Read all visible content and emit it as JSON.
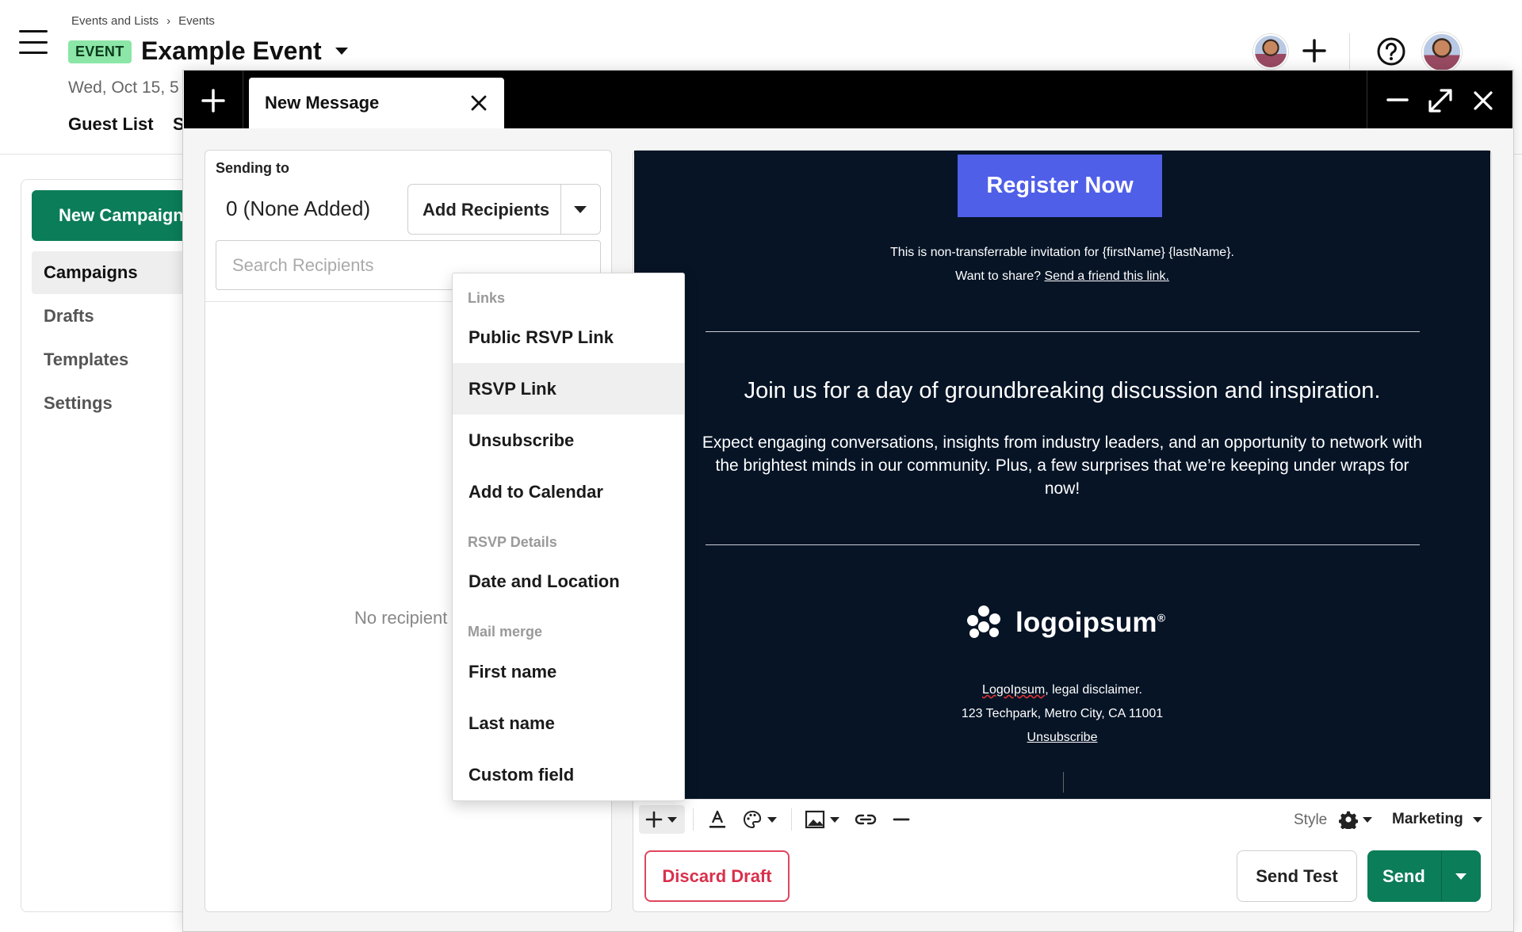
{
  "header": {
    "breadcrumb": [
      "Events and Lists",
      "Events"
    ],
    "breadcrumb_separator": "›",
    "badge": "EVENT",
    "title": "Example Event",
    "date": "Wed, Oct 15, 5",
    "tabs": [
      "Guest List",
      "S"
    ]
  },
  "sidebar": {
    "new_campaign": "New Campaign",
    "items": [
      "Campaigns",
      "Drafts",
      "Templates",
      "Settings"
    ],
    "active": "Campaigns"
  },
  "composer": {
    "tab_title": "New Message",
    "recipients": {
      "sending_to_label": "Sending to",
      "count_text": "0 (None Added)",
      "add_button": "Add Recipients",
      "search_placeholder": "Search Recipients",
      "empty_text": "No recipient"
    },
    "email": {
      "cta": "Register Now",
      "invite_line": "This is non-transferrable invitation for {firstName} {lastName}.",
      "share_prefix": "Want to share?",
      "share_link": "Send a friend this link.",
      "headline": "Join us for a day of groundbreaking discussion and inspiration.",
      "body": "Expect engaging conversations, insights from industry leaders, and an opportunity to network with the brightest minds in our community. Plus, a few surprises that we’re keeping under wraps for now!",
      "logo_text": "logoipsum",
      "logo_mark": "®",
      "disclaimer_brand": "LogoIpsum",
      "disclaimer_rest": ", legal disclaimer.",
      "address": "123 Techpark, Metro City, CA 11001",
      "unsubscribe": "Unsubscribe"
    },
    "toolbar": {
      "style_label": "Style",
      "template_label": "Marketing",
      "icons": [
        "plus-icon",
        "text-color-icon",
        "palette-icon",
        "image-icon",
        "link-icon",
        "divider-icon",
        "gear-icon"
      ]
    },
    "footer": {
      "discard": "Discard Draft",
      "send_test": "Send Test",
      "send": "Send"
    }
  },
  "insert_menu": {
    "sections": [
      {
        "header": "Links",
        "items": [
          "Public RSVP Link",
          "RSVP Link",
          "Unsubscribe",
          "Add to Calendar"
        ]
      },
      {
        "header": "RSVP Details",
        "items": [
          "Date and Location"
        ]
      },
      {
        "header": "Mail merge",
        "items": [
          "First name",
          "Last name",
          "Custom field"
        ]
      }
    ],
    "highlighted": "RSVP Link"
  },
  "colors": {
    "brand_green": "#0b7d58",
    "event_badge": "#8ce6a7",
    "cta_blue": "#4f5fe8",
    "email_bg": "#061426",
    "discard_red": "#d9304c"
  }
}
